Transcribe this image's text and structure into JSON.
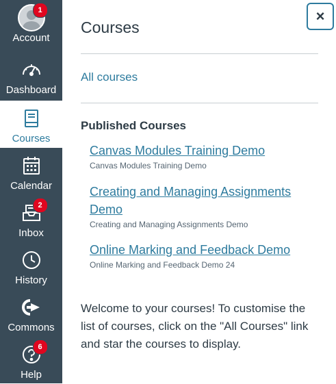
{
  "sidebar": {
    "items": [
      {
        "label": "Account",
        "badge": "1"
      },
      {
        "label": "Dashboard",
        "badge": ""
      },
      {
        "label": "Courses",
        "badge": ""
      },
      {
        "label": "Calendar",
        "badge": ""
      },
      {
        "label": "Inbox",
        "badge": "2"
      },
      {
        "label": "History",
        "badge": ""
      },
      {
        "label": "Commons",
        "badge": ""
      },
      {
        "label": "Help",
        "badge": "6"
      }
    ]
  },
  "tray": {
    "title": "Courses",
    "close_icon": "×",
    "all_courses_link": "All courses",
    "published_heading": "Published Courses",
    "courses": [
      {
        "name": "Canvas Modules Training Demo",
        "subtitle": "Canvas Modules Training Demo"
      },
      {
        "name": "Creating and Managing Assignments Demo",
        "subtitle": "Creating and Managing Assignments Demo"
      },
      {
        "name": "Online Marking and Feedback Demo",
        "subtitle": "Online Marking and Feedback Demo 24"
      }
    ],
    "welcome_text": "Welcome to your courses! To customise the list of courses, click on the \"All Courses\" link and star the courses to display."
  },
  "colors": {
    "sidebar_bg": "#394b58",
    "link": "#2d7b9e",
    "badge": "#e0061f"
  }
}
